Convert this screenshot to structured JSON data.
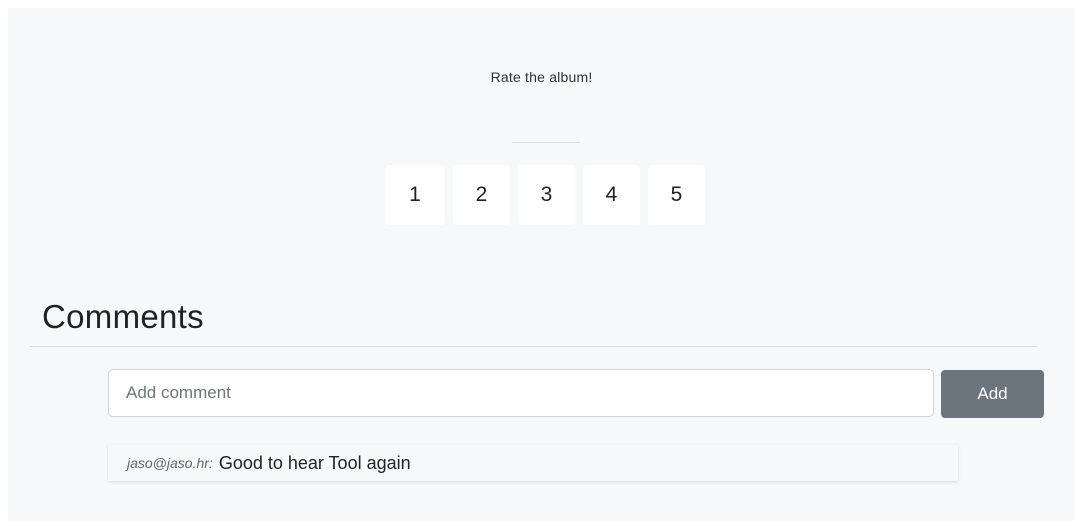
{
  "rating": {
    "prompt": "Rate the album!",
    "options": [
      "1",
      "2",
      "3",
      "4",
      "5"
    ]
  },
  "comments": {
    "heading": "Comments",
    "input_placeholder": "Add comment",
    "add_label": "Add",
    "items": [
      {
        "author": "jaso@jaso.hr:",
        "text": "Good to hear Tool again"
      }
    ]
  }
}
